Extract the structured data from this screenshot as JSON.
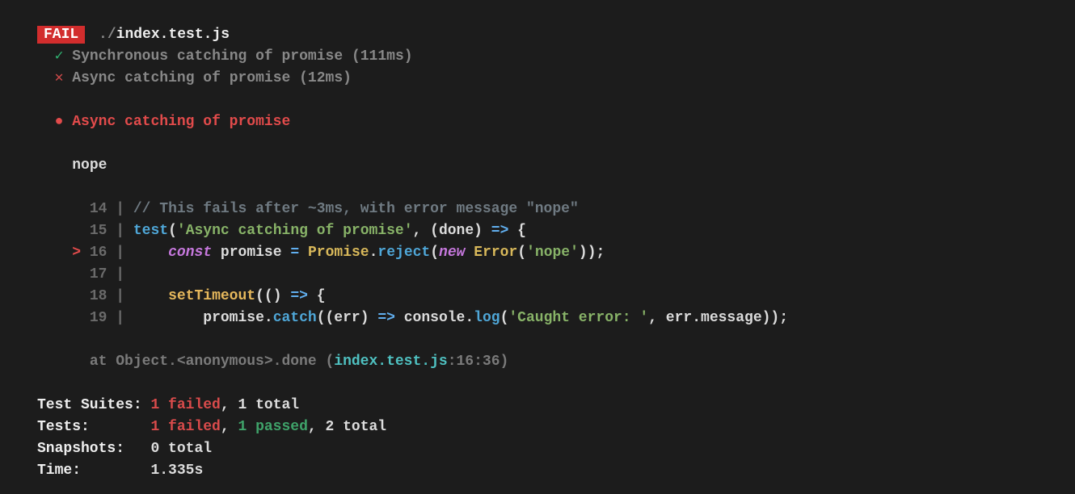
{
  "badge": "FAIL",
  "file_prefix": "./",
  "file_name": "index.test.js",
  "tests": {
    "pass": {
      "icon": "✓",
      "name": "Synchronous catching of promise",
      "time": "(111ms)"
    },
    "fail": {
      "icon": "✕",
      "name": "Async catching of promise",
      "time": "(12ms)"
    }
  },
  "failure": {
    "bullet": "●",
    "title": "Async catching of promise",
    "message": "nope"
  },
  "code": {
    "l14": {
      "num": "14",
      "comment": "// This fails after ~3ms, with error message \"nope\""
    },
    "l15": {
      "num": "15",
      "fn": "test",
      "str": "'Async catching of promise'",
      "rest1": ", (done) ",
      "arrow": "=>",
      "rest2": " {"
    },
    "l16": {
      "arrow": ">",
      "num": "16",
      "kw": "const",
      "var": "promise",
      "eq": "=",
      "klass": "Promise",
      "method": "reject",
      "newkw": "new",
      "errtype": "Error",
      "errstr": "'nope'"
    },
    "l17": {
      "num": "17"
    },
    "l18": {
      "num": "18",
      "call": "setTimeout",
      "rest1": "(() ",
      "arrow": "=>",
      "rest2": " {"
    },
    "l19": {
      "num": "19",
      "obj": "promise.",
      "method": "catch",
      "rest1": "((err) ",
      "arrow": "=>",
      "rest2": " console.",
      "log": "log",
      "str": "'Caught error: '",
      "rest3": ", err.message));"
    }
  },
  "stack": {
    "prefix": "at Object.<anonymous>.done (",
    "file": "index.test.js",
    "loc": ":16:36",
    "suffix": ")"
  },
  "summary": {
    "suites": {
      "label": "Test Suites:",
      "fail": "1 failed",
      "rest": ", 1 total"
    },
    "tests": {
      "label": "Tests:",
      "fail": "1 failed",
      "sep": ", ",
      "pass": "1 passed",
      "rest": ", 2 total"
    },
    "snaps": {
      "label": "Snapshots:",
      "rest": "0 total"
    },
    "time": {
      "label": "Time:",
      "rest": "1.335s"
    }
  }
}
